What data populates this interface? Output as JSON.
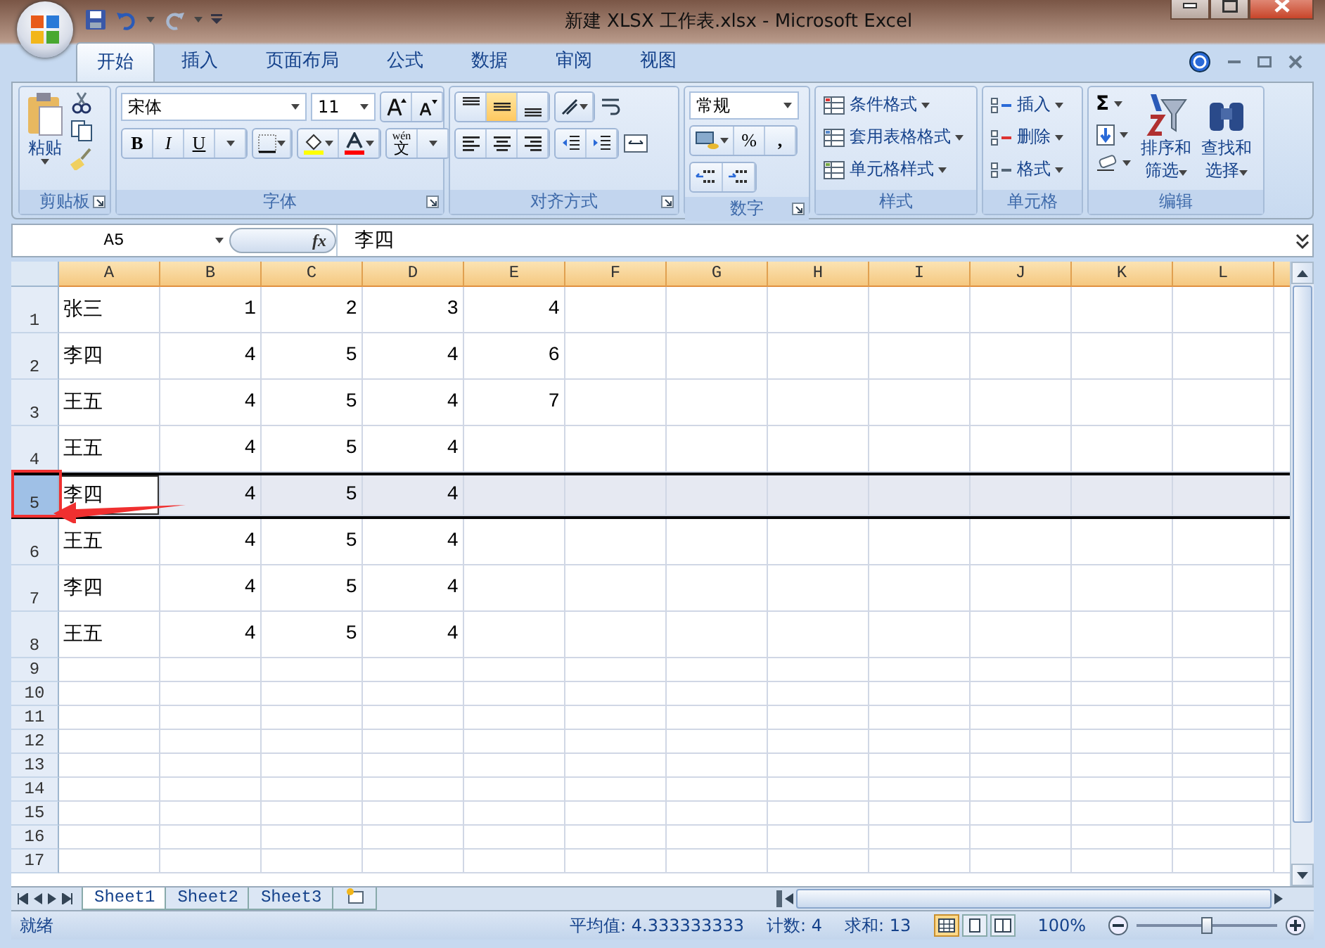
{
  "window": {
    "title": "新建 XLSX 工作表.xlsx - Microsoft Excel"
  },
  "tabs": [
    {
      "label": "开始",
      "selected": true
    },
    {
      "label": "插入",
      "selected": false
    },
    {
      "label": "页面布局",
      "selected": false
    },
    {
      "label": "公式",
      "selected": false
    },
    {
      "label": "数据",
      "selected": false
    },
    {
      "label": "审阅",
      "selected": false
    },
    {
      "label": "视图",
      "selected": false
    }
  ],
  "ribbon": {
    "clipboard": {
      "paste": "粘贴",
      "label": "剪贴板"
    },
    "font": {
      "name": "宋体",
      "size": "11",
      "bold": "B",
      "italic": "I",
      "underline": "U",
      "phonetic_top": "wén",
      "phonetic": "文",
      "label": "字体"
    },
    "alignment": {
      "label": "对齐方式",
      "center_selected": true
    },
    "number": {
      "format": "常规",
      "percent": "%",
      "comma": ",",
      "label": "数字"
    },
    "styles": {
      "items": [
        "条件格式",
        "套用表格格式",
        "单元格样式"
      ],
      "label": "样式"
    },
    "cells": {
      "items": [
        "插入",
        "删除",
        "格式"
      ],
      "label": "单元格"
    },
    "editing": {
      "sum": "Σ",
      "sort": [
        "排序和",
        "筛选"
      ],
      "find": [
        "查找和",
        "选择"
      ],
      "label": "编辑"
    }
  },
  "formula_bar": {
    "name_box": "A5",
    "fx": "fx",
    "value": "李四"
  },
  "columns": [
    "A",
    "B",
    "C",
    "D",
    "E",
    "F",
    "G",
    "H",
    "I",
    "J",
    "K",
    "L"
  ],
  "rows": [
    {
      "header": "1",
      "selected": false,
      "cells": [
        {
          "value": "张三",
          "active": false
        },
        {
          "value": "1",
          "active": false
        },
        {
          "value": "2",
          "active": false
        },
        {
          "value": "3",
          "active": false
        },
        {
          "value": "4",
          "active": false
        }
      ]
    },
    {
      "header": "2",
      "selected": false,
      "cells": [
        {
          "value": "李四",
          "active": false
        },
        {
          "value": "4",
          "active": false
        },
        {
          "value": "5",
          "active": false
        },
        {
          "value": "4",
          "active": false
        },
        {
          "value": "6",
          "active": false
        }
      ]
    },
    {
      "header": "3",
      "selected": false,
      "cells": [
        {
          "value": "王五",
          "active": false
        },
        {
          "value": "4",
          "active": false
        },
        {
          "value": "5",
          "active": false
        },
        {
          "value": "4",
          "active": false
        },
        {
          "value": "7",
          "active": false
        }
      ]
    },
    {
      "header": "4",
      "selected": false,
      "cells": [
        {
          "value": "王五",
          "active": false
        },
        {
          "value": "4",
          "active": false
        },
        {
          "value": "5",
          "active": false
        },
        {
          "value": "4",
          "active": false
        }
      ]
    },
    {
      "header": "5",
      "selected": true,
      "cells": [
        {
          "value": "李四",
          "active": true
        },
        {
          "value": "4",
          "active": false
        },
        {
          "value": "5",
          "active": false
        },
        {
          "value": "4",
          "active": false
        }
      ]
    },
    {
      "header": "6",
      "selected": false,
      "cells": [
        {
          "value": "王五",
          "active": false
        },
        {
          "value": "4",
          "active": false
        },
        {
          "value": "5",
          "active": false
        },
        {
          "value": "4",
          "active": false
        }
      ]
    },
    {
      "header": "7",
      "selected": false,
      "cells": [
        {
          "value": "李四",
          "active": false
        },
        {
          "value": "4",
          "active": false
        },
        {
          "value": "5",
          "active": false
        },
        {
          "value": "4",
          "active": false
        }
      ]
    },
    {
      "header": "8",
      "selected": false,
      "cells": [
        {
          "value": "王五",
          "active": false
        },
        {
          "value": "4",
          "active": false
        },
        {
          "value": "5",
          "active": false
        },
        {
          "value": "4",
          "active": false
        }
      ]
    },
    {
      "header": "9",
      "selected": false,
      "cells": []
    },
    {
      "header": "10",
      "selected": false,
      "cells": []
    },
    {
      "header": "11",
      "selected": false,
      "cells": []
    },
    {
      "header": "12",
      "selected": false,
      "cells": []
    },
    {
      "header": "13",
      "selected": false,
      "cells": []
    },
    {
      "header": "14",
      "selected": false,
      "cells": []
    },
    {
      "header": "15",
      "selected": false,
      "cells": []
    },
    {
      "header": "16",
      "selected": false,
      "cells": []
    },
    {
      "header": "17",
      "selected": false,
      "cells": []
    }
  ],
  "sheets": [
    {
      "label": "Sheet1",
      "selected": true
    },
    {
      "label": "Sheet2",
      "selected": false
    },
    {
      "label": "Sheet3",
      "selected": false
    }
  ],
  "status_bar": {
    "mode": "就绪",
    "average": "平均值: 4.333333333",
    "count": "计数: 4",
    "sum": "求和: 13",
    "zoom": "100%",
    "zoom_slider": {
      "level": 0.5
    }
  }
}
